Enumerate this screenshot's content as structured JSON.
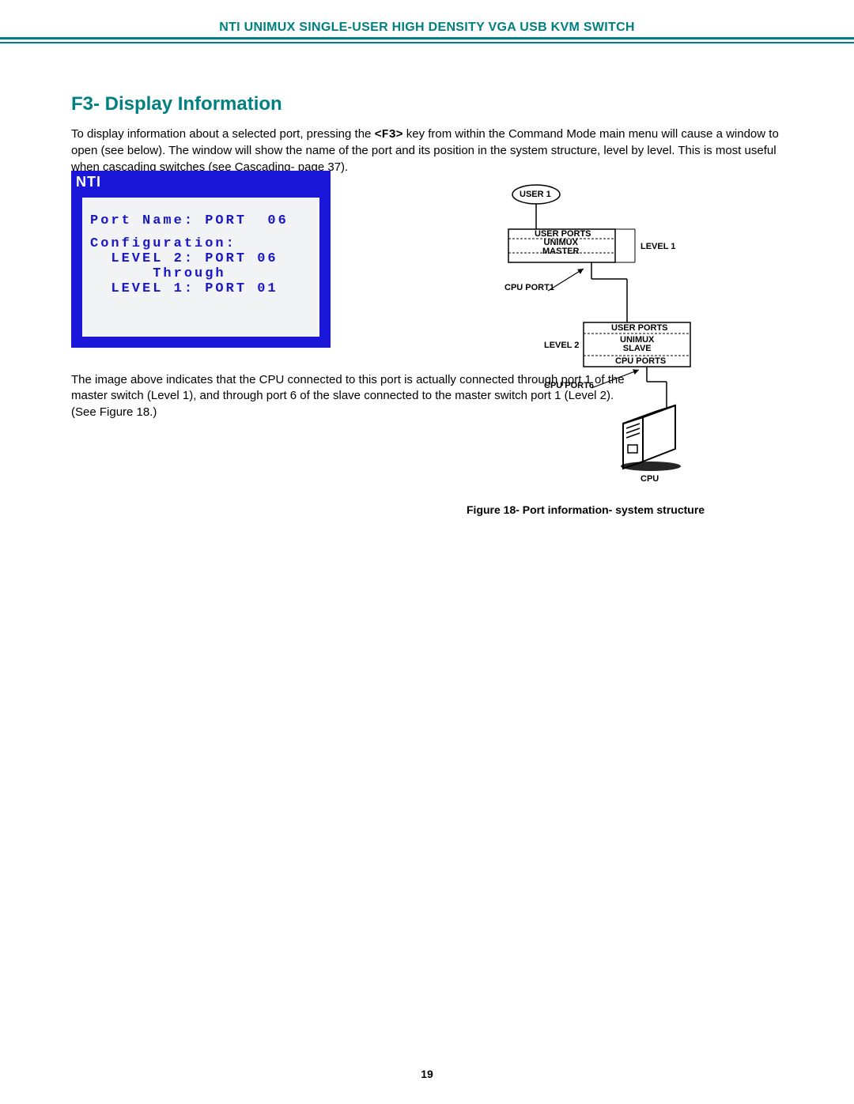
{
  "header": "NTI UNIMUX SINGLE-USER HIGH DENSITY VGA USB KVM SWITCH",
  "section_title": "F3- Display Information",
  "intro_pre": "To display information about a selected port, pressing the ",
  "intro_key": "<F3>",
  "intro_post": " key from within the Command Mode main menu will cause a window to open (see below).  The window will show the name of the port and its position in the system structure, level by level. This is most useful when cascading switches  (see Cascading-   page 37).",
  "screenshot": {
    "logo": "NTI",
    "l1": "Port Name: PORT  06",
    "l2": "Configuration:",
    "l3": "  LEVEL 2: PORT 06",
    "l4": "      Through",
    "l5": "  LEVEL 1: PORT 01"
  },
  "caption_below": "The image above indicates that the CPU connected to this port is actually connected through port 1 of the master switch (Level 1),  and through port 6 of the slave connected to the master switch port 1 (Level 2).    (See Figure 18.)",
  "diagram": {
    "user1": "USER 1",
    "user_ports1": "USER PORTS",
    "master": "UNIMUX\nMASTER",
    "level1": "LEVEL 1",
    "cpu_port1": "CPU PORT1",
    "user_ports2": "USER PORTS",
    "slave": "UNIMUX\nSLAVE",
    "cpu_ports": "CPU PORTS",
    "level2": "LEVEL 2",
    "cpu_port6": "CPU PORT6",
    "cpu": "CPU"
  },
  "figure_caption": "Figure 18- Port information- system structure",
  "page_number": "19"
}
